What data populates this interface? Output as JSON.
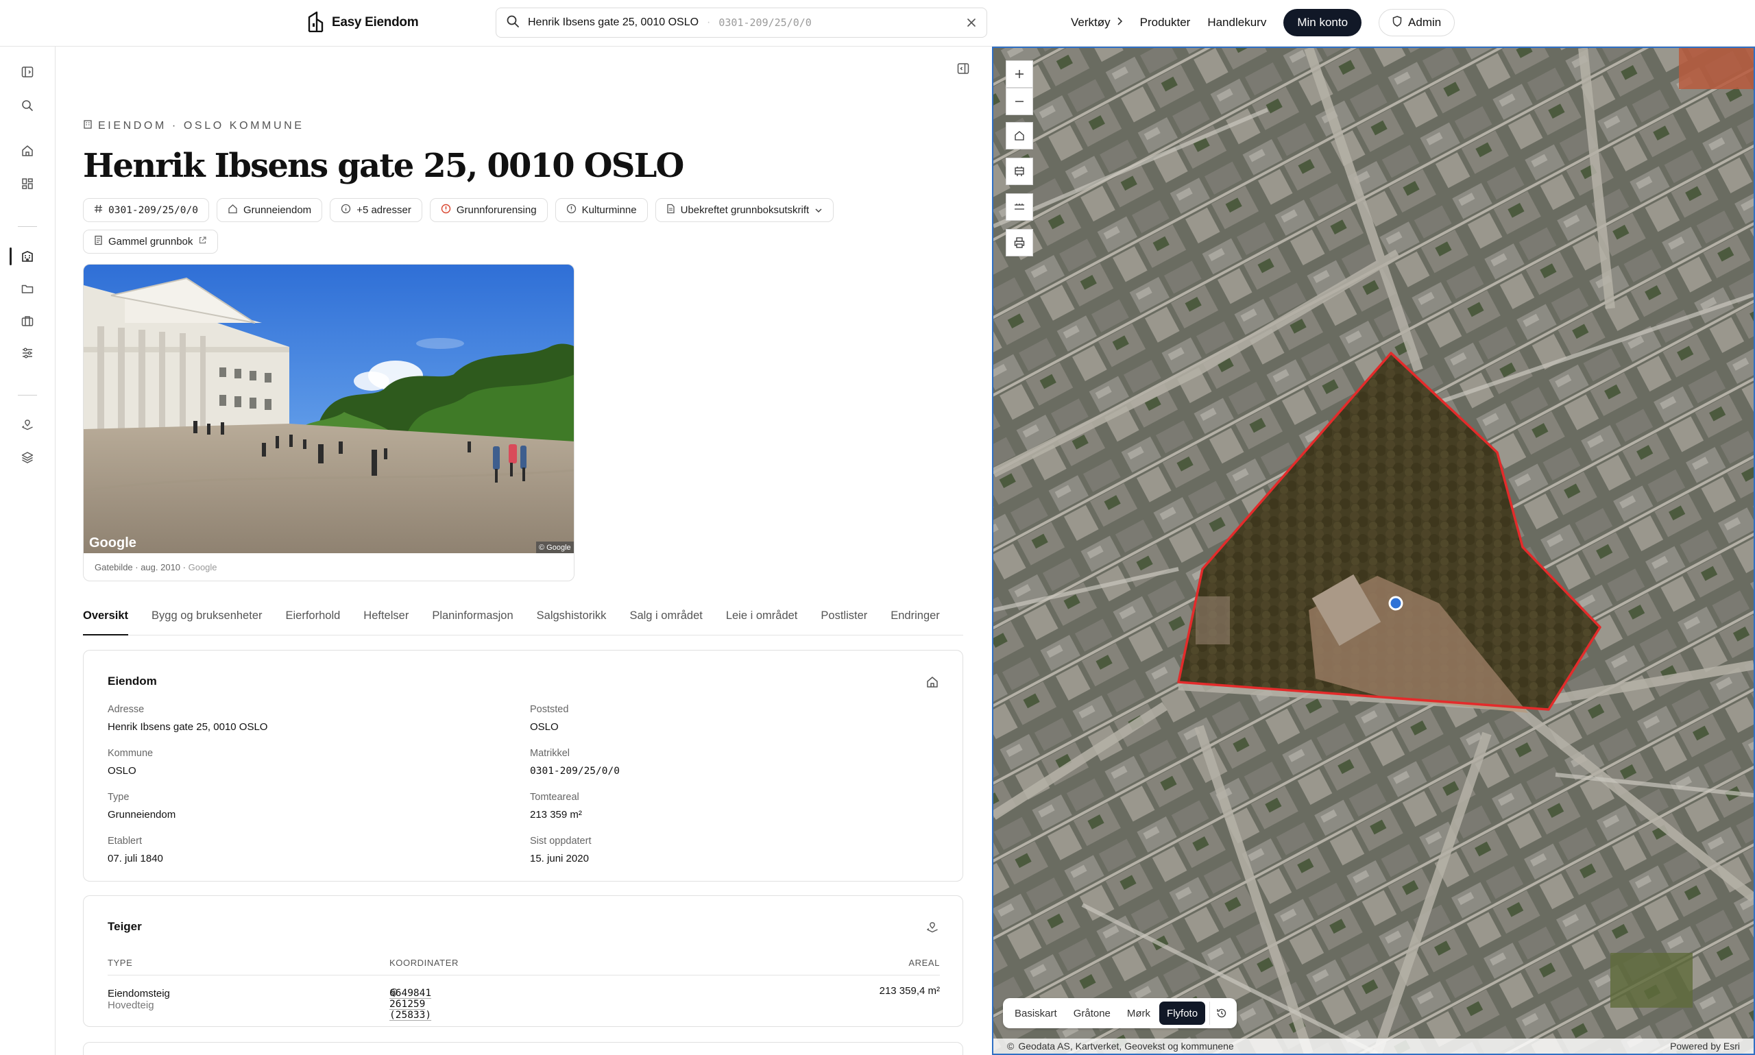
{
  "app": {
    "brand": "Easy Eiendom"
  },
  "search": {
    "query": "Henrik Ibsens gate 25, 0010 OSLO",
    "matrikkel": "0301-209/25/0/0"
  },
  "nav": {
    "tools": "Verktøy",
    "products": "Produkter",
    "cart": "Handlekurv",
    "account": "Min konto",
    "admin": "Admin"
  },
  "property": {
    "eyebrow": "EIENDOM · OSLO KOMMUNE",
    "title": "Henrik Ibsens gate 25, 0010 OSLO",
    "chips": {
      "matrikkel": "0301-209/25/0/0",
      "type": "Grunneiendom",
      "addresses": "+5 adresser",
      "pollution": "Grunnforurensing",
      "heritage": "Kulturminne",
      "extract": "Ubekreftet grunnboksutskrift",
      "old_register": "Gammel grunnbok"
    },
    "photo": {
      "label_prefix": "Gatebilde · aug. 2010 ·",
      "source": "Google",
      "watermark": "Google",
      "copyright": "© Google"
    }
  },
  "tabs": [
    "Oversikt",
    "Bygg og bruksenheter",
    "Eierforhold",
    "Heftelser",
    "Planinformasjon",
    "Salgshistorikk",
    "Salg i området",
    "Leie i området",
    "Postlister",
    "Endringer"
  ],
  "eiendom_card": {
    "title": "Eiendom",
    "fields": [
      {
        "label": "Adresse",
        "value": "Henrik Ibsens gate 25, 0010 OSLO"
      },
      {
        "label": "Poststed",
        "value": "OSLO"
      },
      {
        "label": "Kommune",
        "value": "OSLO"
      },
      {
        "label": "Matrikkel",
        "value": "0301-209/25/0/0"
      },
      {
        "label": "Type",
        "value": "Grunneiendom"
      },
      {
        "label": "Tomteareal",
        "value": "213 359 m²"
      },
      {
        "label": "Etablert",
        "value": "07. juli 1840"
      },
      {
        "label": "Sist oppdatert",
        "value": "15. juni 2020"
      }
    ]
  },
  "teiger_card": {
    "title": "Teiger",
    "headers": {
      "type": "TYPE",
      "coords": "KOORDINATER",
      "area": "AREAL"
    },
    "row": {
      "type": "Eiendomsteig",
      "subtype": "- Hovedteig",
      "coords": "6649841 261259 (25833)",
      "area": "213 359,4 m²"
    }
  },
  "map": {
    "basemaps": [
      "Basiskart",
      "Gråtone",
      "Mørk",
      "Flyfoto"
    ],
    "active_basemap": "Flyfoto",
    "attribution": "Geodata AS, Kartverket, Geovekst og kommunene",
    "powered_by": "Powered by Esri",
    "colors": {
      "boundary": "#e32b2b",
      "marker": "#2f72d6",
      "frame": "#2f6fc4"
    }
  }
}
